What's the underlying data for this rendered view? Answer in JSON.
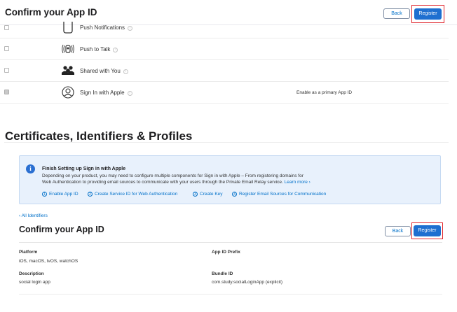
{
  "header": {
    "title": "Confirm your App ID",
    "back_label": "Back",
    "register_label": "Register"
  },
  "capabilities": [
    {
      "label": "Push Notifications",
      "icon": "bell-icon",
      "checked": false,
      "extra": ""
    },
    {
      "label": "Push to Talk",
      "icon": "push-to-talk-icon",
      "checked": false,
      "extra": ""
    },
    {
      "label": "Shared with You",
      "icon": "people-icon",
      "checked": false,
      "extra": ""
    },
    {
      "label": "Sign In with Apple",
      "icon": "person-circle-icon",
      "checked": true,
      "extra": "Enable as a primary App ID"
    }
  ],
  "section_title": "Certificates, Identifiers & Profiles",
  "banner": {
    "icon": "info-icon",
    "title": "Finish Setting up Sign in with Apple",
    "line1": "Depending on your product, you may need to configure multiple components for Sign in with Apple – From registering domains for",
    "line2": "Web Authentication to providing email sources to communicate with your users through the Private Email Relay service.",
    "learn_more": "Learn more ›",
    "steps": [
      {
        "num": "1",
        "label": "Enable App ID"
      },
      {
        "num": "2",
        "label": "Create Service ID for Web Authentication"
      },
      {
        "num": "3",
        "label": "Create Key"
      },
      {
        "num": "4",
        "label": "Register Email Sources for Communication"
      }
    ]
  },
  "breadcrumb": "‹ All Identifiers",
  "confirm": {
    "title": "Confirm your App ID",
    "back_label": "Back",
    "register_label": "Register",
    "platform_label": "Platform",
    "platform_value": "iOS, macOS, tvOS, watchOS",
    "prefix_label": "App ID Prefix",
    "prefix_value": "",
    "description_label": "Description",
    "description_value": "social login app",
    "bundle_label": "Bundle ID",
    "bundle_value": "com.study.socialLoginApp (explicit)"
  },
  "colors": {
    "accent": "#0070c9",
    "register_bg": "#1e6fd0",
    "highlight": "#e0242c",
    "banner_bg": "#e8f1fc"
  }
}
